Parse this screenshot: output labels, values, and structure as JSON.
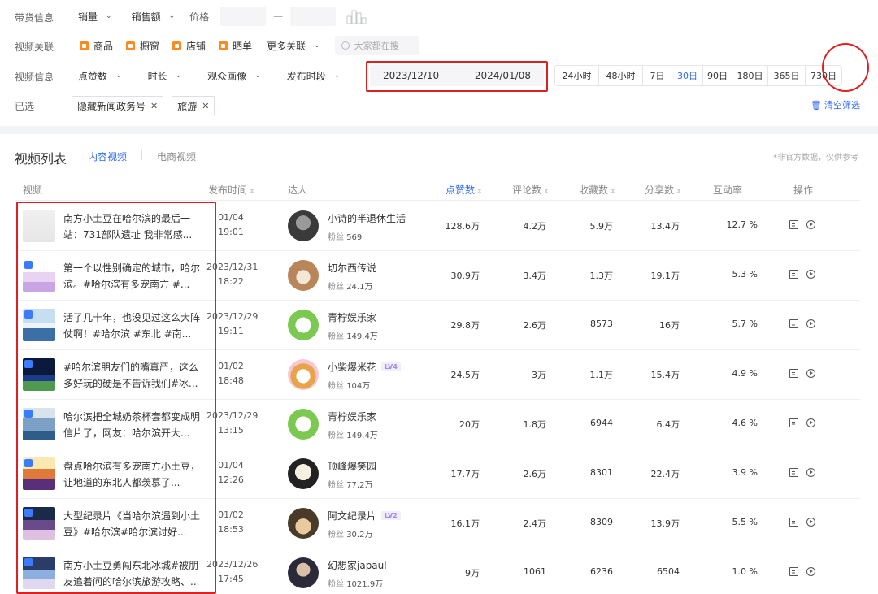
{
  "filters": {
    "goods_label": "带货信息",
    "goods_dropdowns": [
      "销量",
      "销售额"
    ],
    "price_label": "价格",
    "price_sep": "—",
    "assoc_label": "视频关联",
    "assoc_items": [
      "商品",
      "橱窗",
      "店铺",
      "晒单"
    ],
    "more_assoc": "更多关联",
    "search_placeholder": "大家都在搜",
    "info_label": "视频信息",
    "info_dropdowns": [
      "点赞数",
      "时长",
      "观众画像",
      "发布时段"
    ],
    "date_start": "2023/12/10",
    "date_sep": "-",
    "date_end": "2024/01/08",
    "ranges": [
      "24小时",
      "48小时",
      "7日",
      "30日",
      "90日",
      "180日",
      "365日",
      "730日"
    ],
    "active_range": "30日",
    "selected_label": "已选",
    "selected_tags": [
      "隐藏新闻政务号",
      "旅游"
    ],
    "clear_label": "清空筛选"
  },
  "list": {
    "title": "视频列表",
    "tab_content": "内容视频",
    "tab_ecom": "电商视频",
    "disclaimer": "*非官方数据，仅供参考",
    "headers": {
      "video": "视频",
      "publish_time": "发布时间",
      "author": "达人",
      "likes": "点赞数",
      "comments": "评论数",
      "favorites": "收藏数",
      "shares": "分享数",
      "engagement": "互动率",
      "actions": "操作"
    },
    "fans_prefix": "粉丝",
    "rows": [
      {
        "title": "南方小土豆在哈尔滨的最后一站：731部队遗址 我非常感...",
        "date": "01/04",
        "time": "19:01",
        "author": "小诗的半退休生活",
        "level": "",
        "fans": "569",
        "likes": "128.6万",
        "comments": "4.2万",
        "favorites": "5.9万",
        "shares": "13.4万",
        "rate": "12.7 %"
      },
      {
        "title": "第一个以性别确定的城市，哈尔滨。#哈尔滨有多宠南方 #...",
        "date": "2023/12/31",
        "time": "18:22",
        "author": "切尔西传说",
        "level": "",
        "fans": "24.1万",
        "likes": "30.9万",
        "comments": "3.4万",
        "favorites": "1.3万",
        "shares": "19.1万",
        "rate": "5.3 %"
      },
      {
        "title": "活了几十年，也没见过这么大阵仗啊！#哈尔滨 #东北 #南...",
        "date": "2023/12/29",
        "time": "19:11",
        "author": "青柠娱乐家",
        "level": "",
        "fans": "149.4万",
        "likes": "29.8万",
        "comments": "2.6万",
        "favorites": "8573",
        "shares": "16万",
        "rate": "5.7 %"
      },
      {
        "title": "#哈尔滨朋友们的嘴真严，这么多好玩的硬是不告诉我们#冰...",
        "date": "01/02",
        "time": "18:48",
        "author": "小柴爆米花",
        "level": "LV4",
        "fans": "104万",
        "likes": "24.5万",
        "comments": "3万",
        "favorites": "1.1万",
        "shares": "15.4万",
        "rate": "4.9 %"
      },
      {
        "title": "哈尔滨把全城奶茶杯套都变成明信片了，网友：哈尔滨开大...",
        "date": "2023/12/29",
        "time": "13:15",
        "author": "青柠娱乐家",
        "level": "",
        "fans": "149.4万",
        "likes": "20万",
        "comments": "1.8万",
        "favorites": "6944",
        "shares": "6.4万",
        "rate": "4.6 %"
      },
      {
        "title": "盘点哈尔滨有多宠南方小土豆，让地道的东北人都羡慕了...",
        "date": "01/04",
        "time": "12:26",
        "author": "顶峰爆笑园",
        "level": "",
        "fans": "77.2万",
        "likes": "17.7万",
        "comments": "2.6万",
        "favorites": "8301",
        "shares": "22.4万",
        "rate": "3.9 %"
      },
      {
        "title": "大型纪录片《当哈尔滨遇到小土豆》#哈尔滨#哈尔滨讨好...",
        "date": "01/02",
        "time": "18:53",
        "author": "阿文纪录片",
        "level": "LV2",
        "fans": "30.2万",
        "likes": "16.1万",
        "comments": "2.4万",
        "favorites": "8309",
        "shares": "13.9万",
        "rate": "5.5 %"
      },
      {
        "title": "南方小土豆勇闯东北冰城#被朋友追着问的哈尔滨旅游攻略、...",
        "date": "2023/12/26",
        "time": "17:45",
        "author": "幻想家japaul",
        "level": "",
        "fans": "1021.9万",
        "likes": "9万",
        "comments": "1061",
        "favorites": "6236",
        "shares": "6504",
        "rate": "1.0 %"
      }
    ]
  },
  "colors": {
    "accent": "#2e6bf0",
    "highlight": "#e02020",
    "chip": "#ff8a1f"
  }
}
